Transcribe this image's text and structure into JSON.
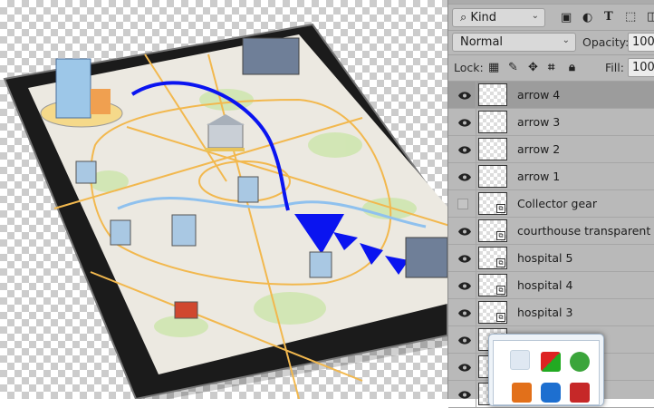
{
  "layers_panel": {
    "filter": {
      "kind_label": "Kind"
    },
    "blend_mode": "Normal",
    "opacity": {
      "label": "Opacity:",
      "value": "100%"
    },
    "lock_label": "Lock:",
    "fill": {
      "label": "Fill:",
      "value": "100%"
    },
    "layers": [
      {
        "name": "arrow 4",
        "visible": true,
        "active": true,
        "smart": false
      },
      {
        "name": "arrow 3",
        "visible": true,
        "smart": false
      },
      {
        "name": "arrow 2",
        "visible": true,
        "smart": false
      },
      {
        "name": "arrow 1",
        "visible": true,
        "smart": false
      },
      {
        "name": "Collector gear",
        "visible": false,
        "smart": true
      },
      {
        "name": "courthouse transparent",
        "visible": true,
        "smart": true
      },
      {
        "name": "hospital 5",
        "visible": true,
        "smart": true
      },
      {
        "name": "hospital 4",
        "visible": true,
        "smart": true
      },
      {
        "name": "hospital 3",
        "visible": true,
        "smart": true
      }
    ]
  },
  "colors": {
    "route": "#0a14f0",
    "panel": "#b9b9b9",
    "map": "#ece9e1"
  }
}
